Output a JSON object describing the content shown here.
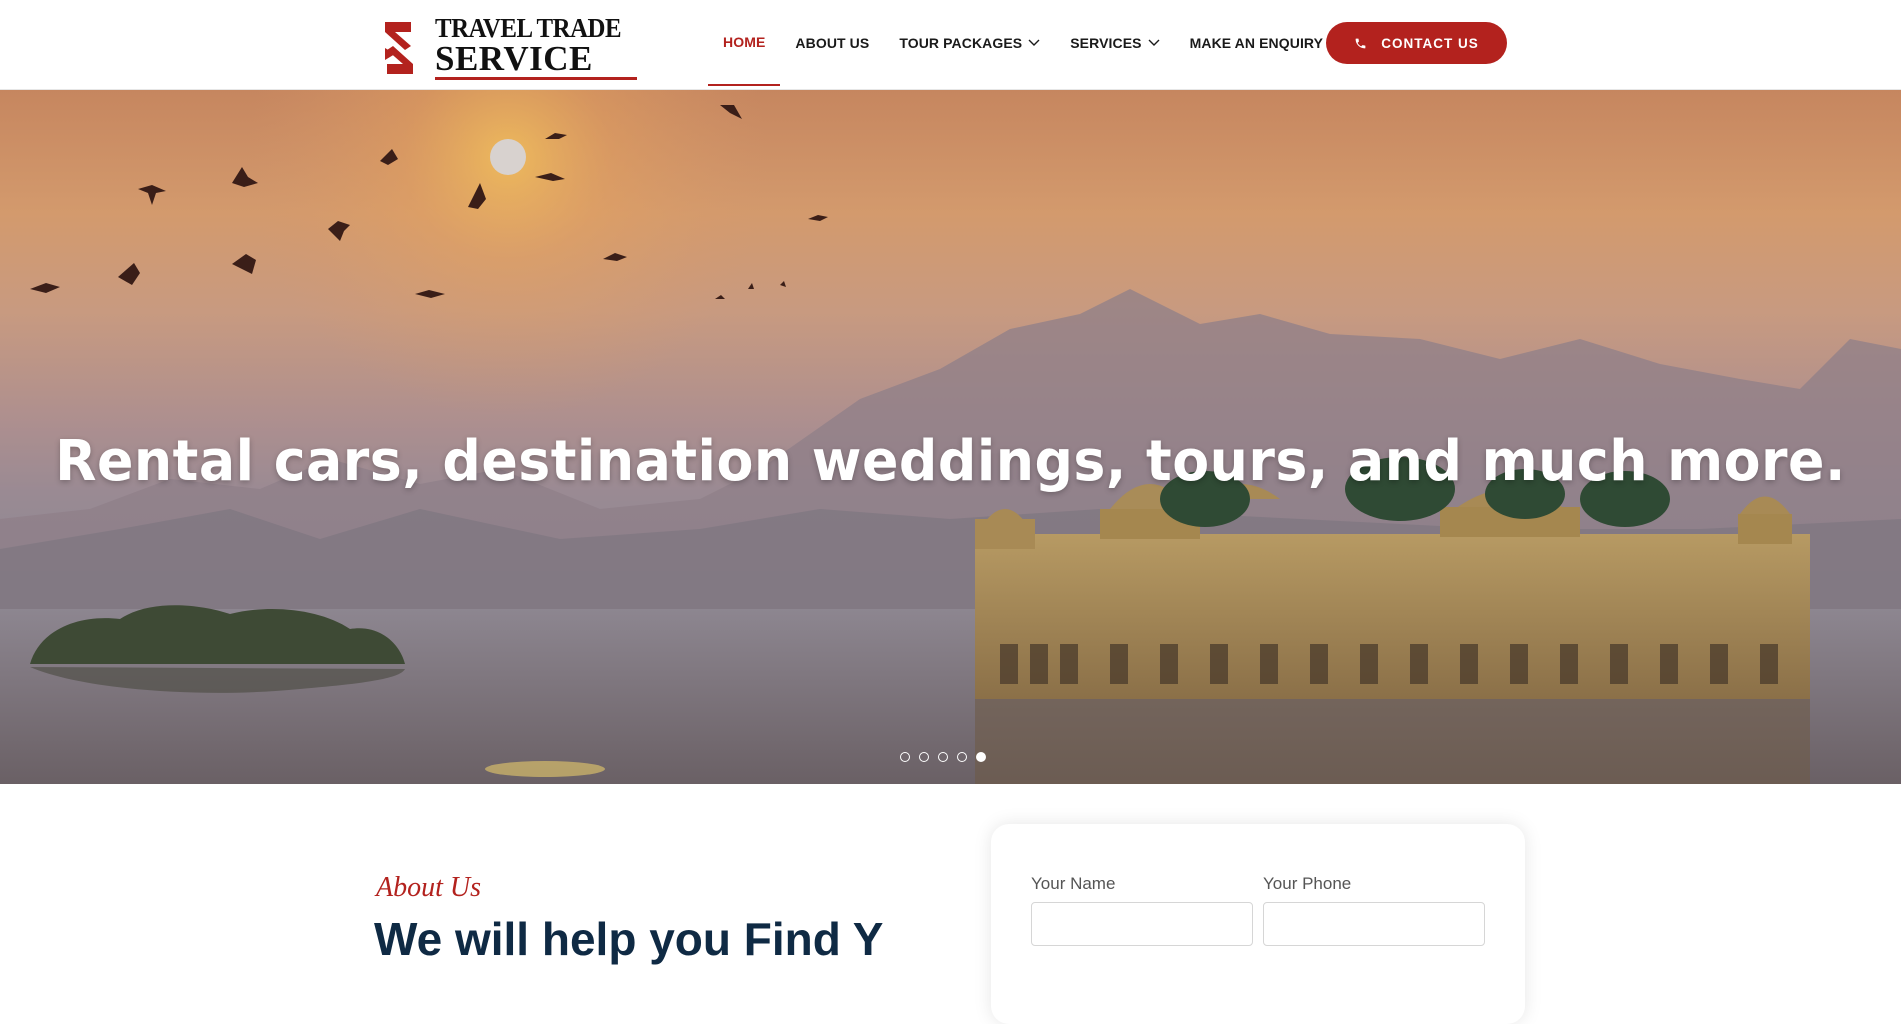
{
  "brand": {
    "line1": "TRAVEL TRADE",
    "line2": "SERVICE",
    "accent_color": "#b3221e"
  },
  "nav": {
    "items": [
      {
        "label": "HOME",
        "active": true
      },
      {
        "label": "ABOUT US"
      },
      {
        "label": "TOUR PACKAGES",
        "dropdown": true
      },
      {
        "label": "SERVICES",
        "dropdown": true
      },
      {
        "label": "MAKE AN ENQUIRY"
      }
    ],
    "contact_label": "CONTACT US",
    "contact_icon": "phone-icon"
  },
  "hero": {
    "heading": "Rental cars, destination weddings, tours, and much more.",
    "slides": 5,
    "active_slide": 5
  },
  "about": {
    "tag": "About Us",
    "heading": "We will help you Find Y"
  },
  "form": {
    "name_label": "Your Name",
    "phone_label": "Your Phone"
  }
}
